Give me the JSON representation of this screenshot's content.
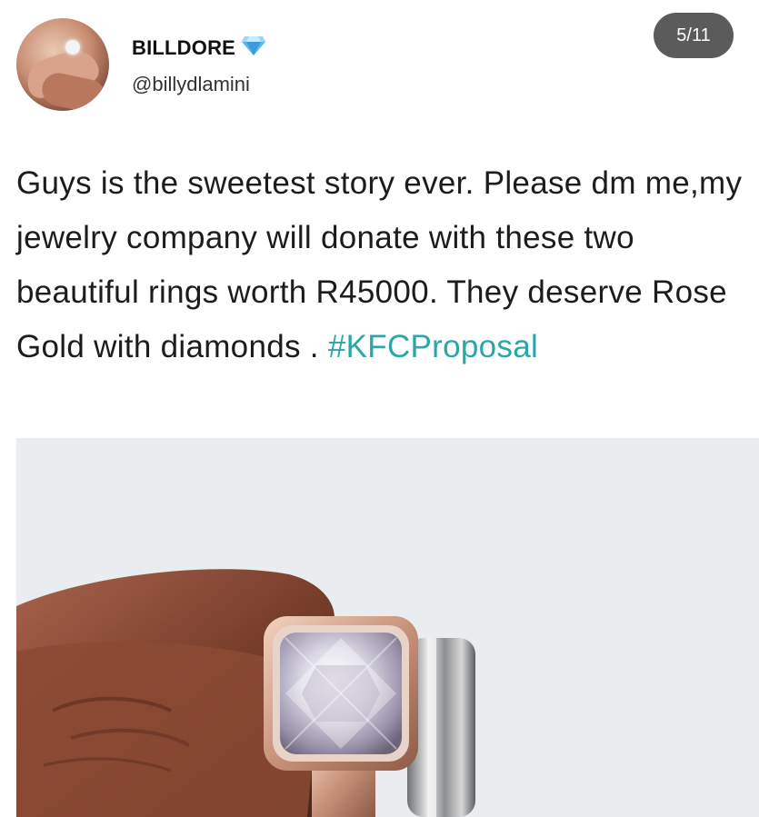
{
  "post": {
    "author_name": "BILLDORE",
    "verified_icon": "blue-diamond-icon",
    "author_handle": "@billydlamini",
    "page_counter": "5/11",
    "text_main": "Guys is the sweetest story ever. Please dm me,my jewelry company will donate with these two beautiful rings worth R45000. They deserve Rose Gold with diamonds . ",
    "hashtag": "#KFCProposal"
  },
  "colors": {
    "hashtag": "#2aa7a6",
    "counter_bg": "#5b5b5b",
    "diamond": "#5fb6ea"
  }
}
